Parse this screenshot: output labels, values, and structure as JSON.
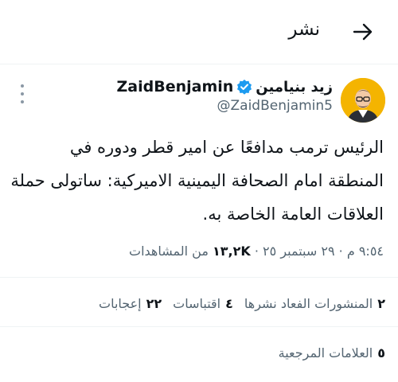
{
  "header": {
    "title": "نشر",
    "back_icon": "arrow-right-icon"
  },
  "author": {
    "display_name_en": "ZaidBenjamin",
    "display_name_ar": "زيد بنيامين",
    "handle": "@ZaidBenjamin5",
    "verified_icon": "verified-badge-icon",
    "verified_color": "#1d9bf0"
  },
  "tweet": {
    "text": "الرئيس ترمب مدافعًا عن امير قطر ودوره في المنطقة امام الصحافة اليمينية الاميركية: ساتولى حملة العلاقات العامة الخاصة به.",
    "time": "٩:٥٤ م",
    "date": "٢٩ سبتمبر ٢٥",
    "views_count": "١٣,٢K",
    "views_label": "من المشاهدات"
  },
  "stats": {
    "reposts_count": "٢",
    "reposts_label": "المنشورات الفعاد نشرها",
    "quotes_count": "٤",
    "quotes_label": "اقتباسات",
    "likes_count": "٢٢",
    "likes_label": "إعجابات",
    "bookmarks_count": "٥",
    "bookmarks_label": "العلامات المرجعية"
  },
  "colors": {
    "text": "#0f1419",
    "secondary": "#536471",
    "divider": "#eff3f4",
    "accent": "#1d9bf0"
  }
}
